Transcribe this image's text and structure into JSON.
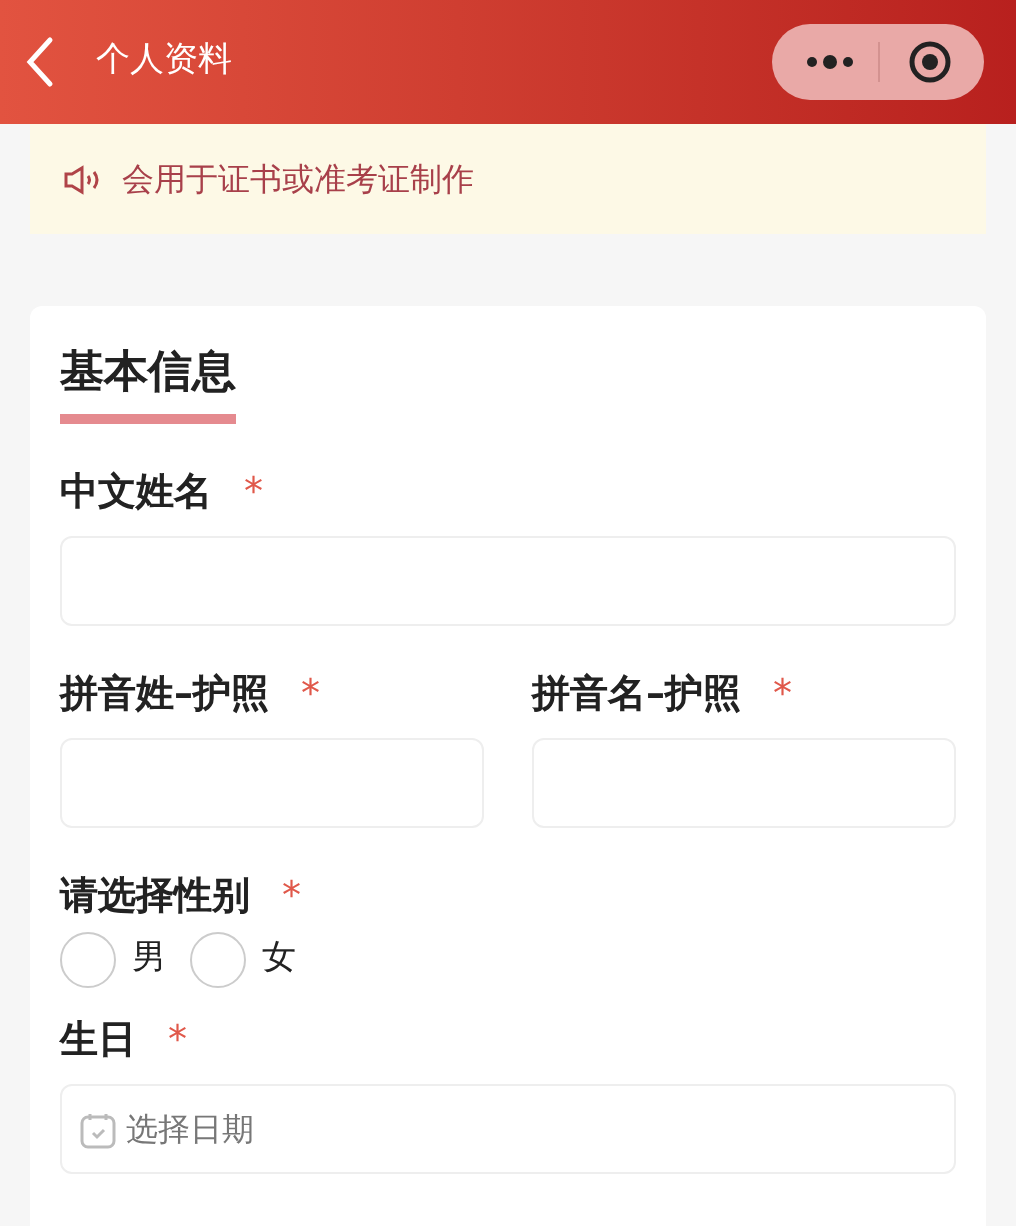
{
  "nav_bar": {
    "title": "个人资料"
  },
  "notice": {
    "text": "会用于证书或准考证制作"
  },
  "section": {
    "title": "基本信息"
  },
  "fields": [
    {
      "kind": "text",
      "label": "中文姓名",
      "required_mark": "*"
    },
    {
      "kind": "text_pair",
      "items": [
        {
          "label": "拼音姓–护照",
          "required_mark": "*"
        },
        {
          "label": "拼音名–护照",
          "required_mark": "*"
        }
      ]
    },
    {
      "kind": "radio",
      "label": "请选择性别",
      "required_mark": "*",
      "options": [
        {
          "label": "男",
          "selected": false
        },
        {
          "label": "女",
          "selected": false
        }
      ]
    },
    {
      "kind": "date",
      "label": "生日",
      "required_mark": "*",
      "placeholder": "选择日期"
    }
  ]
}
